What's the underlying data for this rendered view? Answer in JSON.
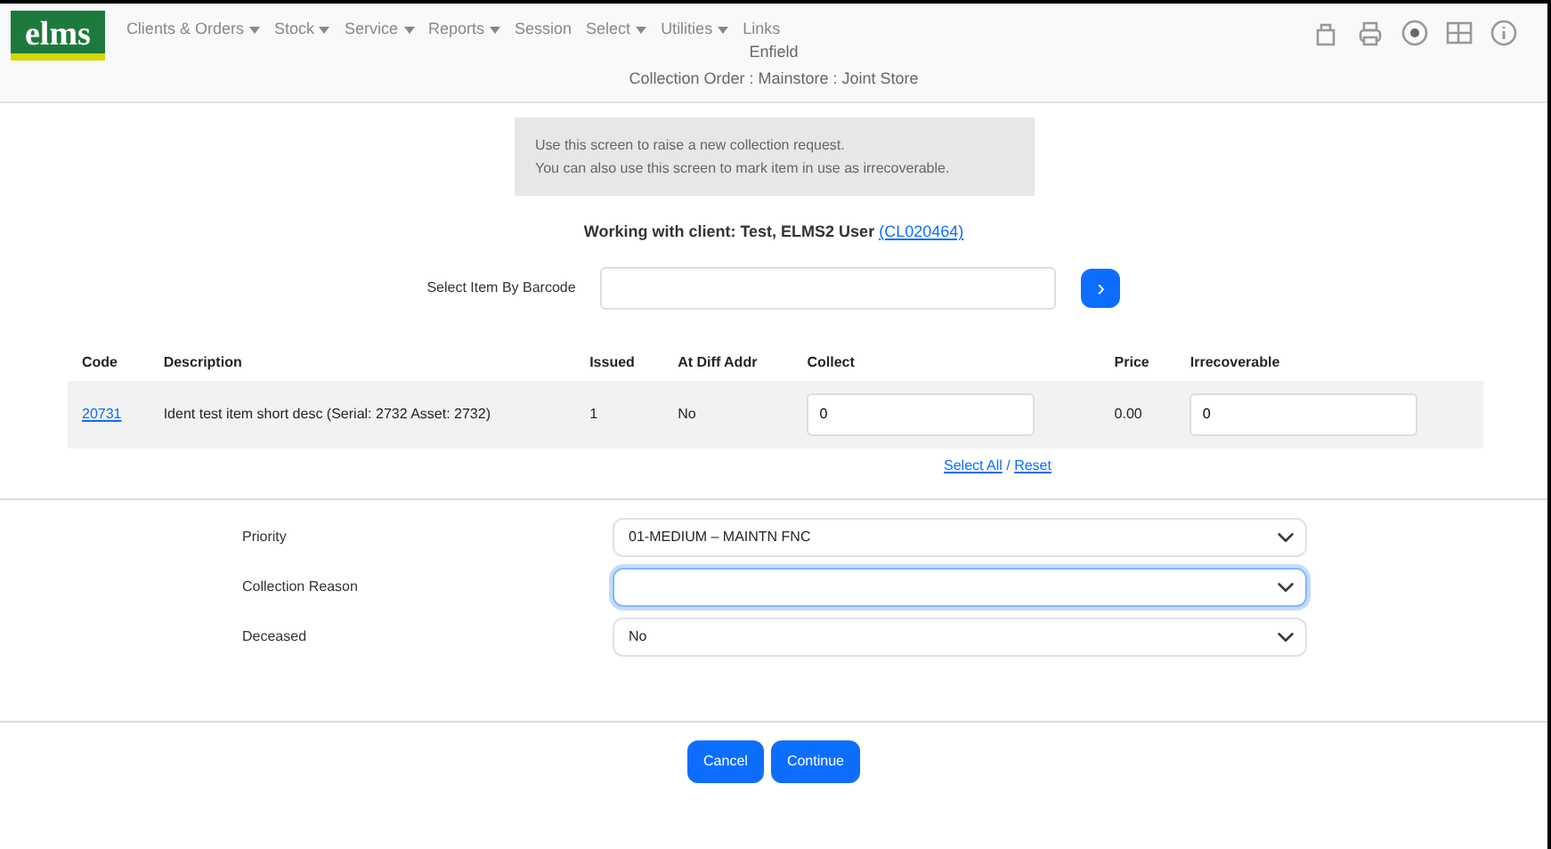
{
  "logo": {
    "text": "elms"
  },
  "menu": [
    {
      "label": "Clients & Orders",
      "dropdown": true
    },
    {
      "label": "Stock",
      "dropdown": true
    },
    {
      "label": "Service",
      "dropdown": true
    },
    {
      "label": "Reports",
      "dropdown": true
    },
    {
      "label": "Session",
      "dropdown": false
    },
    {
      "label": "Select",
      "dropdown": true
    },
    {
      "label": "Utilities",
      "dropdown": true
    },
    {
      "label": "Links",
      "dropdown": false
    }
  ],
  "header": {
    "site": "Enfield",
    "title": "Collection Order : Mainstore : Joint Store"
  },
  "info": [
    "Use this screen to raise a new collection request.",
    "You can also use this screen to mark item in use as irrecoverable."
  ],
  "client": {
    "text": "Working with client: Test, ELMS2 User",
    "code": "(CL020464)"
  },
  "barcode": {
    "label": "Select Item By Barcode",
    "button": "›"
  },
  "table": {
    "columns": [
      "Code",
      "Description",
      "Issued",
      "At Diff Addr",
      "Collect",
      "Price",
      "Irrecoverable"
    ],
    "rows": [
      {
        "code": "20731",
        "description": "Ident test item short desc (Serial: 2732 Asset: 2732)",
        "issued": "1",
        "diff_addr": "No",
        "collect": "0",
        "price": "0.00",
        "irrecoverable": "0"
      }
    ]
  },
  "select_links": [
    "Select All",
    "Reset"
  ],
  "select_separator": "/",
  "fields": [
    {
      "label": "Priority",
      "value": "01-MEDIUM – MAINTN FNC",
      "focused": false
    },
    {
      "label": "Collection Reason",
      "focused": true
    },
    {
      "label": "Deceased",
      "value": "No",
      "focused": false
    }
  ],
  "buttons": [
    "Cancel",
    "Continue"
  ]
}
